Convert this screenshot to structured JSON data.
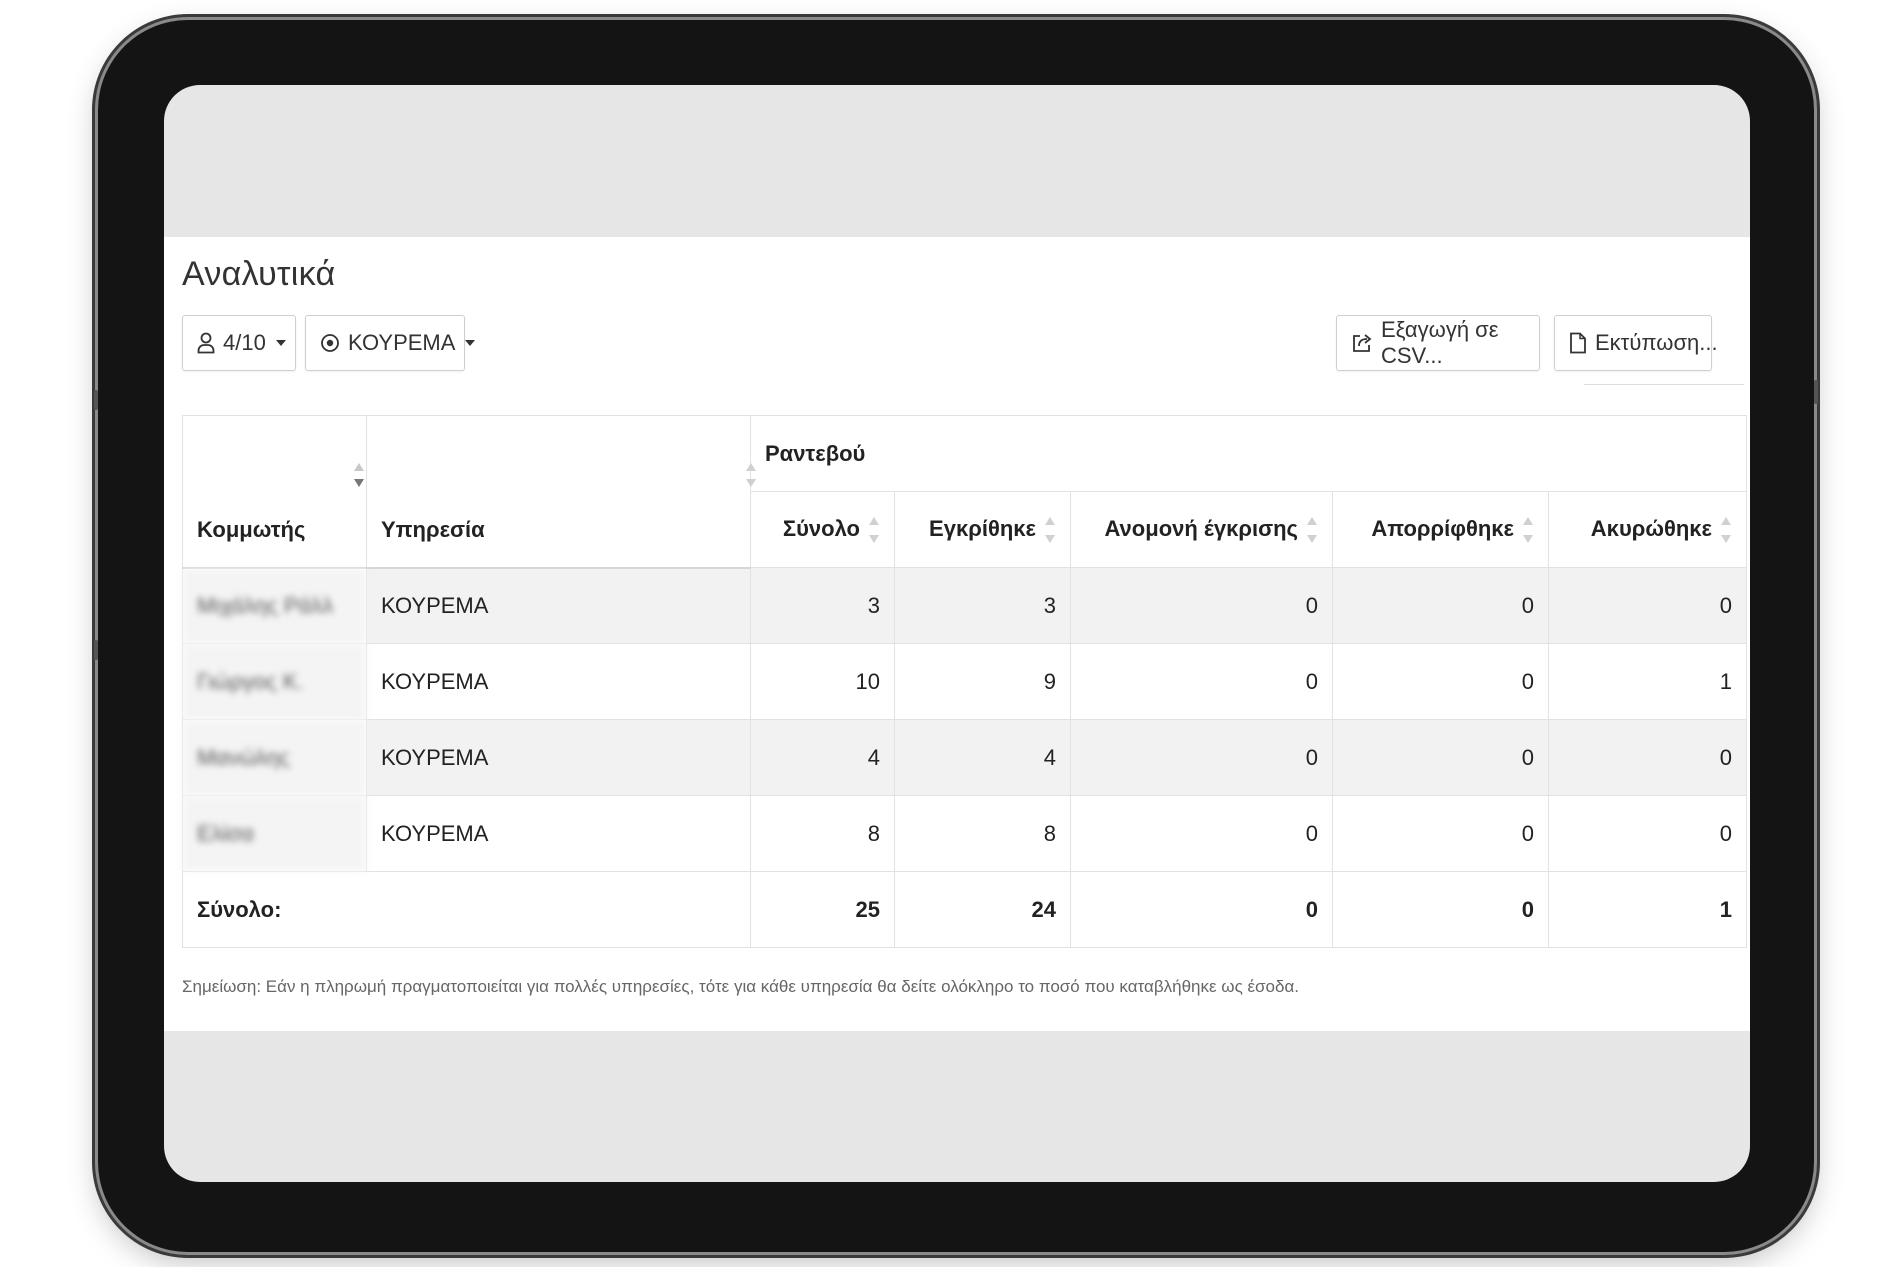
{
  "page": {
    "title": "Αναλυτικά",
    "note": "Σημείωση: Εάν η πληρωμή πραγματοποιείται για πολλές υπηρεσίες, τότε για κάθε υπηρεσία θα δείτε ολόκληρο το ποσό που καταβλήθηκε ως έσοδα."
  },
  "toolbar": {
    "staff_filter": {
      "icon": "user-icon",
      "label": "4/10"
    },
    "service_filter": {
      "icon": "service-target-icon",
      "label": "ΚΟΥΡΕΜΑ"
    },
    "export_button": {
      "icon": "export-icon",
      "label": "Εξαγωγή σε CSV..."
    },
    "print_button": {
      "icon": "file-icon",
      "label": "Εκτύπωση..."
    }
  },
  "table": {
    "group_header": "Ραντεβού",
    "columns": {
      "barber": "Κομμωτής",
      "service": "Υπηρεσία",
      "total": "Σύνολο",
      "approved": "Εγκρίθηκε",
      "pending": "Ανομονή έγκρισης",
      "rejected": "Απορρίφθηκε",
      "cancelled": "Ακυρώθηκε"
    },
    "rows": [
      {
        "barber": "Μιχάλης Ράλλ",
        "service": "ΚΟΥΡΕΜΑ",
        "total": "3",
        "approved": "3",
        "pending": "0",
        "rejected": "0",
        "cancelled": "0"
      },
      {
        "barber": "Γιώργος Κ.",
        "service": "ΚΟΥΡΕΜΑ",
        "total": "10",
        "approved": "9",
        "pending": "0",
        "rejected": "0",
        "cancelled": "1"
      },
      {
        "barber": "Μανώλης",
        "service": "ΚΟΥΡΕΜΑ",
        "total": "4",
        "approved": "4",
        "pending": "0",
        "rejected": "0",
        "cancelled": "0"
      },
      {
        "barber": "Ελίσα",
        "service": "ΚΟΥΡΕΜΑ",
        "total": "8",
        "approved": "8",
        "pending": "0",
        "rejected": "0",
        "cancelled": "0"
      }
    ],
    "totals": {
      "label": "Σύνολο:",
      "total": "25",
      "approved": "24",
      "pending": "0",
      "rejected": "0",
      "cancelled": "1"
    }
  }
}
